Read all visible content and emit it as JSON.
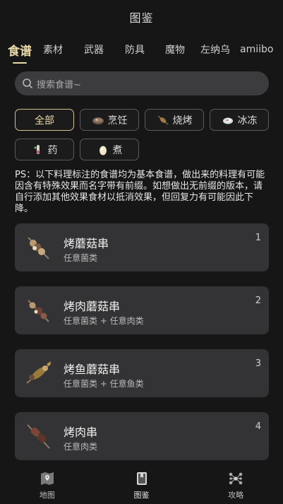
{
  "header": {
    "title": "图鉴"
  },
  "tabs": [
    {
      "label": "食谱",
      "active": true
    },
    {
      "label": "素材"
    },
    {
      "label": "武器"
    },
    {
      "label": "防具"
    },
    {
      "label": "魔物"
    },
    {
      "label": "左纳乌"
    },
    {
      "label": "amiibo"
    }
  ],
  "search": {
    "placeholder": "搜索食谱~"
  },
  "filters": [
    {
      "label": "全部",
      "icon": "",
      "active": true
    },
    {
      "label": "烹饪",
      "icon": "cooking-pot-icon"
    },
    {
      "label": "烧烤",
      "icon": "roast-icon"
    },
    {
      "label": "冰冻",
      "icon": "frozen-icon"
    },
    {
      "label": "药",
      "icon": "medicine-icon"
    },
    {
      "label": "煮",
      "icon": "egg-icon"
    }
  ],
  "notice": "PS：以下料理标注的食谱均为基本食谱，做出来的料理有可能因含有特殊效果而名字带有前缀。如想做出无前缀的版本，请自行添加其他效果食材以抵消效果，但回复力有可能因此下降。",
  "recipes": [
    {
      "name": "烤蘑菇串",
      "ingredients": "任意菌类",
      "number": "1",
      "icon": "mushroom-skewer-icon"
    },
    {
      "name": "烤肉蘑菇串",
      "ingredients": "任意菌类 + 任意肉类",
      "number": "2",
      "icon": "meat-mushroom-skewer-icon"
    },
    {
      "name": "烤鱼蘑菇串",
      "ingredients": "任意菌类 + 任意鱼类",
      "number": "3",
      "icon": "fish-mushroom-skewer-icon"
    },
    {
      "name": "烤肉串",
      "ingredients": "任意肉类",
      "number": "4",
      "icon": "meat-skewer-icon"
    }
  ],
  "bottom_nav": [
    {
      "label": "地图",
      "icon": "map-icon"
    },
    {
      "label": "图鉴",
      "icon": "book-icon",
      "active": true
    },
    {
      "label": "攻略",
      "icon": "guide-icon"
    }
  ],
  "colors": {
    "accent": "#e9d8a8",
    "background": "#161616",
    "card": "#333335"
  }
}
